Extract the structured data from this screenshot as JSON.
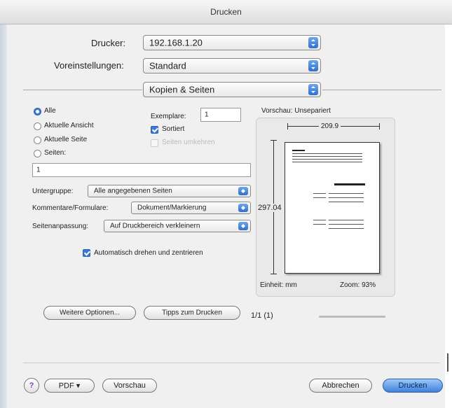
{
  "window": {
    "title": "Drucken"
  },
  "printer": {
    "label": "Drucker:",
    "value": "192.168.1.20"
  },
  "presets": {
    "label": "Voreinstellungen:",
    "value": "Standard"
  },
  "panel": {
    "value": "Kopien & Seiten"
  },
  "range": {
    "options": [
      "Alle",
      "Aktuelle Ansicht",
      "Aktuelle Seite",
      "Seiten:"
    ],
    "selected": "Alle",
    "pages_value": "1"
  },
  "copies": {
    "label": "Exemplare:",
    "value": "1",
    "collated_label": "Sortiert",
    "collated": true,
    "reverse_label": "Seiten umkehren",
    "reverse_enabled": false
  },
  "subset": {
    "label": "Untergruppe:",
    "value": "Alle angegebenen Seiten"
  },
  "comments": {
    "label": "Kommentare/Formulare:",
    "value": "Dokument/Markierung"
  },
  "scaling": {
    "label": "Seitenanpassung:",
    "value": "Auf Druckbereich verkleinern"
  },
  "autorotate": {
    "label": "Automatisch drehen und zentrieren",
    "checked": true
  },
  "preview": {
    "title": "Vorschau: Unsepariert",
    "width_label": "209.9",
    "height_label": "297.04",
    "unit_label": "Einheit: mm",
    "zoom_label": "Zoom: 93%",
    "page_counter": "1/1 (1)"
  },
  "buttons": {
    "more_options": "Weitere Optionen...",
    "tips": "Tipps zum Drucken",
    "help": "?",
    "pdf": "PDF ▾",
    "preview": "Vorschau",
    "cancel": "Abbrechen",
    "print": "Drucken"
  }
}
